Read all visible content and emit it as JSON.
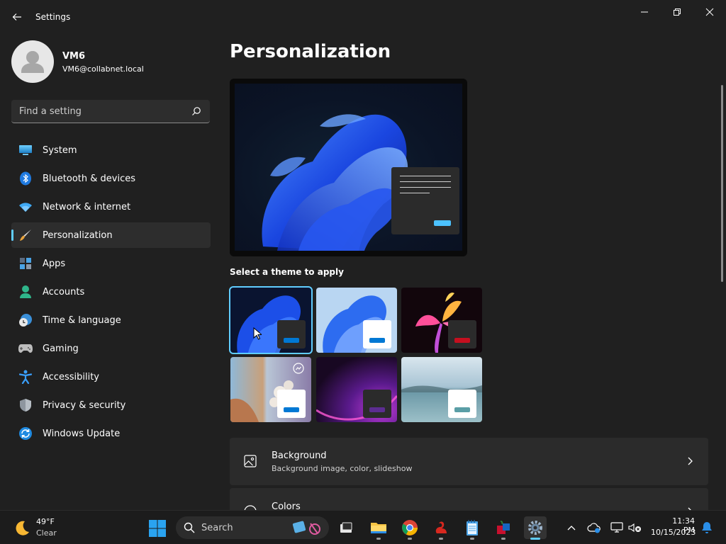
{
  "window": {
    "title": "Settings"
  },
  "user": {
    "name": "VM6",
    "email": "VM6@collabnet.local"
  },
  "search": {
    "placeholder": "Find a setting"
  },
  "sidebar": {
    "items": [
      {
        "label": "System",
        "icon": "system-icon",
        "active": false
      },
      {
        "label": "Bluetooth & devices",
        "icon": "bluetooth-icon",
        "active": false
      },
      {
        "label": "Network & internet",
        "icon": "wifi-icon",
        "active": false
      },
      {
        "label": "Personalization",
        "icon": "brush-icon",
        "active": true
      },
      {
        "label": "Apps",
        "icon": "apps-icon",
        "active": false
      },
      {
        "label": "Accounts",
        "icon": "accounts-icon",
        "active": false
      },
      {
        "label": "Time & language",
        "icon": "clock-globe-icon",
        "active": false
      },
      {
        "label": "Gaming",
        "icon": "gamepad-icon",
        "active": false
      },
      {
        "label": "Accessibility",
        "icon": "accessibility-icon",
        "active": false
      },
      {
        "label": "Privacy & security",
        "icon": "shield-icon",
        "active": false
      },
      {
        "label": "Windows Update",
        "icon": "update-icon",
        "active": false
      }
    ]
  },
  "main": {
    "title": "Personalization",
    "themes_heading": "Select a theme to apply",
    "themes": [
      {
        "name": "windows-dark",
        "accent": "#0078d4",
        "selected": true
      },
      {
        "name": "windows-light",
        "accent": "#0078d4",
        "selected": false
      },
      {
        "name": "glow",
        "accent": "#c50f1f",
        "selected": false
      },
      {
        "name": "captured-motion",
        "accent": "#0078d4",
        "selected": false
      },
      {
        "name": "sunrise",
        "accent": "#5c2d91",
        "selected": false
      },
      {
        "name": "flow",
        "accent": "#5a9ea6",
        "selected": false
      }
    ],
    "cards": [
      {
        "title": "Background",
        "subtitle": "Background image, color, slideshow",
        "icon": "image-icon"
      },
      {
        "title": "Colors",
        "subtitle": "",
        "icon": "palette-icon"
      }
    ]
  },
  "taskbar": {
    "weather": {
      "temp": "49°F",
      "condition": "Clear"
    },
    "search_label": "Search",
    "clock": {
      "time": "11:34 PM",
      "date": "10/15/2023"
    }
  },
  "colors": {
    "accent": "#60cdff",
    "background": "#202020"
  }
}
